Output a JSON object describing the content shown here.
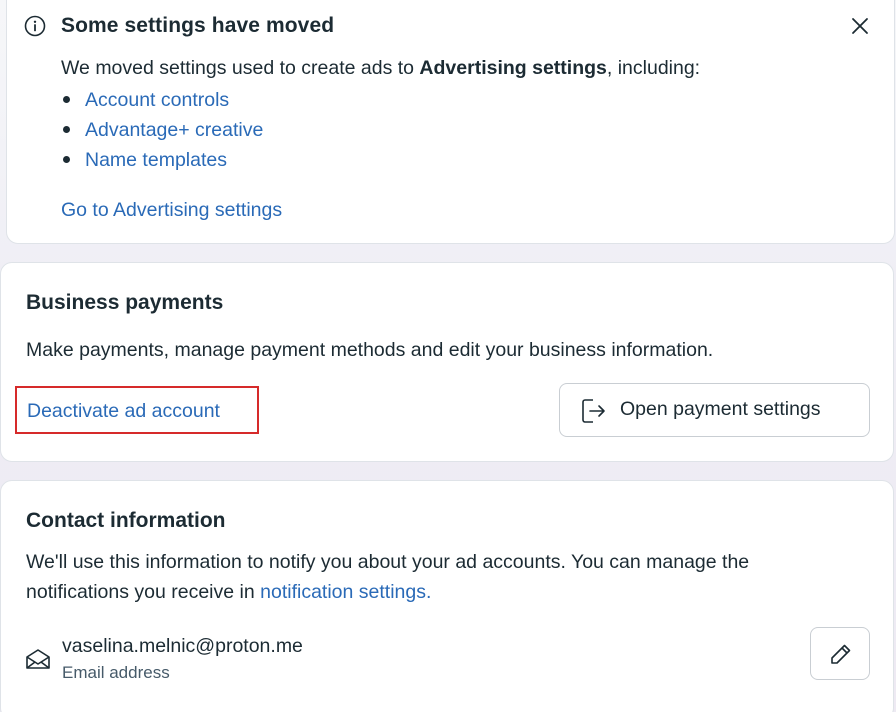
{
  "notice": {
    "title": "Some settings have moved",
    "body_prefix": "We moved settings used to create ads to ",
    "body_bold": "Advertising settings",
    "body_suffix": ", including:",
    "items": [
      "Account controls",
      "Advantage+ creative",
      "Name templates"
    ],
    "goto_link": "Go to Advertising settings",
    "icon": "info-icon",
    "close_icon": "close-icon"
  },
  "payments": {
    "title": "Business payments",
    "description": "Make payments, manage payment methods and edit your business information.",
    "deactivate_link": "Deactivate ad account",
    "open_button": "Open payment settings",
    "open_icon": "external-open-icon",
    "highlight_color": "#d62a2a"
  },
  "contact": {
    "title": "Contact information",
    "description_line1": "We'll use this information to notify you about your ad accounts. You can manage the",
    "description_line2_prefix": "notifications you receive in ",
    "notification_link": "notification settings.",
    "email": "vaselina.melnic@proton.me",
    "email_label": "Email address",
    "email_icon": "envelope-icon",
    "edit_icon": "pencil-icon"
  },
  "colors": {
    "link": "#2a6ab7",
    "text": "#1c2b33"
  }
}
